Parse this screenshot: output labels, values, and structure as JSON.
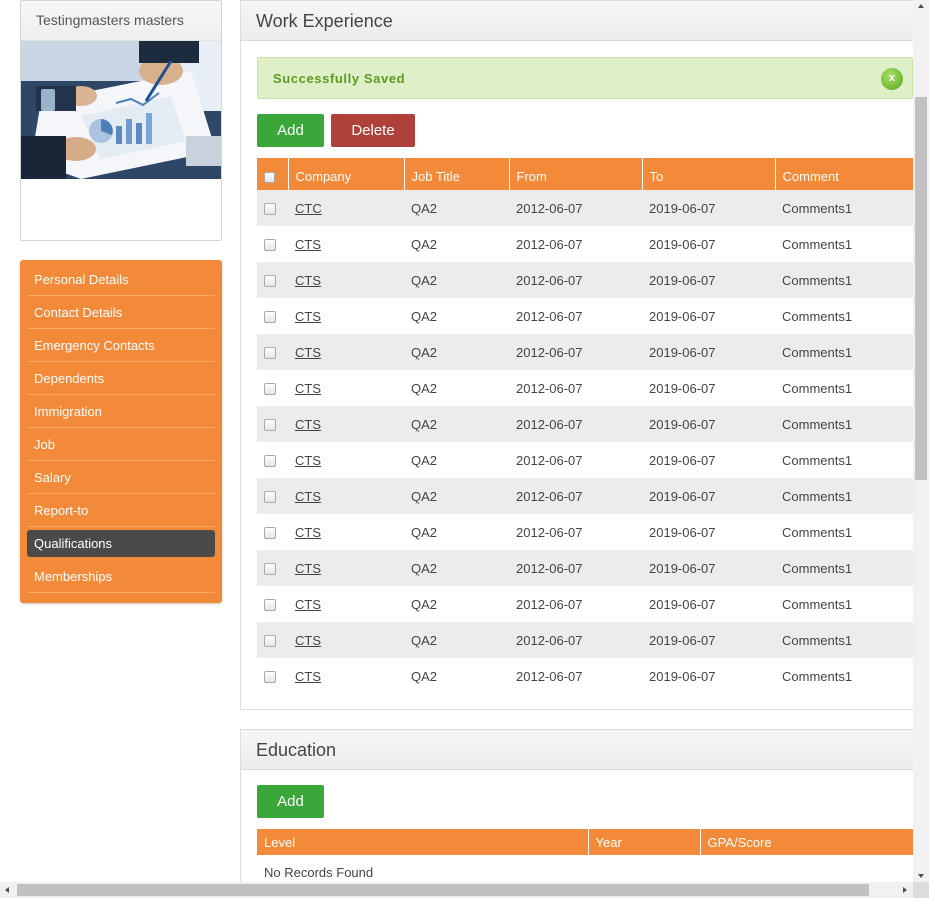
{
  "profile": {
    "name": "Testingmasters masters",
    "photo_icon": "business-chart-photo"
  },
  "side_menu": {
    "items": [
      {
        "label": "Personal Details"
      },
      {
        "label": "Contact Details"
      },
      {
        "label": "Emergency Contacts"
      },
      {
        "label": "Dependents"
      },
      {
        "label": "Immigration"
      },
      {
        "label": "Job"
      },
      {
        "label": "Salary"
      },
      {
        "label": "Report-to"
      },
      {
        "label": "Qualifications",
        "active": true
      },
      {
        "label": "Memberships"
      }
    ]
  },
  "work_experience": {
    "title": "Work Experience",
    "alert": {
      "message": "Successfully Saved",
      "close_label": "x"
    },
    "add_label": "Add",
    "delete_label": "Delete",
    "columns": [
      "Company",
      "Job Title",
      "From",
      "To",
      "Comment"
    ],
    "rows": [
      {
        "company": "CTC",
        "job_title": "QA2",
        "from": "2012-06-07",
        "to": "2019-06-07",
        "comment": "Comments1"
      },
      {
        "company": "CTS",
        "job_title": "QA2",
        "from": "2012-06-07",
        "to": "2019-06-07",
        "comment": "Comments1"
      },
      {
        "company": "CTS",
        "job_title": "QA2",
        "from": "2012-06-07",
        "to": "2019-06-07",
        "comment": "Comments1"
      },
      {
        "company": "CTS",
        "job_title": "QA2",
        "from": "2012-06-07",
        "to": "2019-06-07",
        "comment": "Comments1"
      },
      {
        "company": "CTS",
        "job_title": "QA2",
        "from": "2012-06-07",
        "to": "2019-06-07",
        "comment": "Comments1"
      },
      {
        "company": "CTS",
        "job_title": "QA2",
        "from": "2012-06-07",
        "to": "2019-06-07",
        "comment": "Comments1"
      },
      {
        "company": "CTS",
        "job_title": "QA2",
        "from": "2012-06-07",
        "to": "2019-06-07",
        "comment": "Comments1"
      },
      {
        "company": "CTS",
        "job_title": "QA2",
        "from": "2012-06-07",
        "to": "2019-06-07",
        "comment": "Comments1"
      },
      {
        "company": "CTS",
        "job_title": "QA2",
        "from": "2012-06-07",
        "to": "2019-06-07",
        "comment": "Comments1"
      },
      {
        "company": "CTS",
        "job_title": "QA2",
        "from": "2012-06-07",
        "to": "2019-06-07",
        "comment": "Comments1"
      },
      {
        "company": "CTS",
        "job_title": "QA2",
        "from": "2012-06-07",
        "to": "2019-06-07",
        "comment": "Comments1"
      },
      {
        "company": "CTS",
        "job_title": "QA2",
        "from": "2012-06-07",
        "to": "2019-06-07",
        "comment": "Comments1"
      },
      {
        "company": "CTS",
        "job_title": "QA2",
        "from": "2012-06-07",
        "to": "2019-06-07",
        "comment": "Comments1"
      },
      {
        "company": "CTS",
        "job_title": "QA2",
        "from": "2012-06-07",
        "to": "2019-06-07",
        "comment": "Comments1"
      }
    ]
  },
  "education": {
    "title": "Education",
    "add_label": "Add",
    "columns": [
      "Level",
      "Year",
      "GPA/Score"
    ],
    "empty_message": "No Records Found"
  },
  "colors": {
    "accent_orange": "#f28a3a",
    "active_menu": "#4a4a4a",
    "add_green": "#3ba73b",
    "delete_red": "#b0413a",
    "alert_bg": "#dff0c8",
    "alert_text": "#5c9a22"
  }
}
